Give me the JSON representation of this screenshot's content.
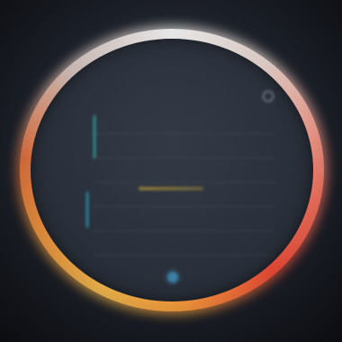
{
  "dial": {
    "title": "",
    "subtitle": "",
    "corner_badge": ""
  },
  "rows": [
    {
      "label": "",
      "value": ""
    },
    {
      "label": "",
      "value": ""
    },
    {
      "label": "",
      "value": ""
    },
    {
      "label": "",
      "value": ""
    },
    {
      "label": "",
      "value": ""
    },
    {
      "label": "",
      "value": ""
    }
  ],
  "icons": {
    "corner": "settings-icon",
    "bottom": "status-dot-icon"
  },
  "colors": {
    "background": "#1c2029",
    "ring_top": "#e6e6e6",
    "ring_right": "#e94a36",
    "ring_bottom": "#ebb24c",
    "accent_teal": "#2fb8b0",
    "accent_blue": "#3c7fa8"
  }
}
